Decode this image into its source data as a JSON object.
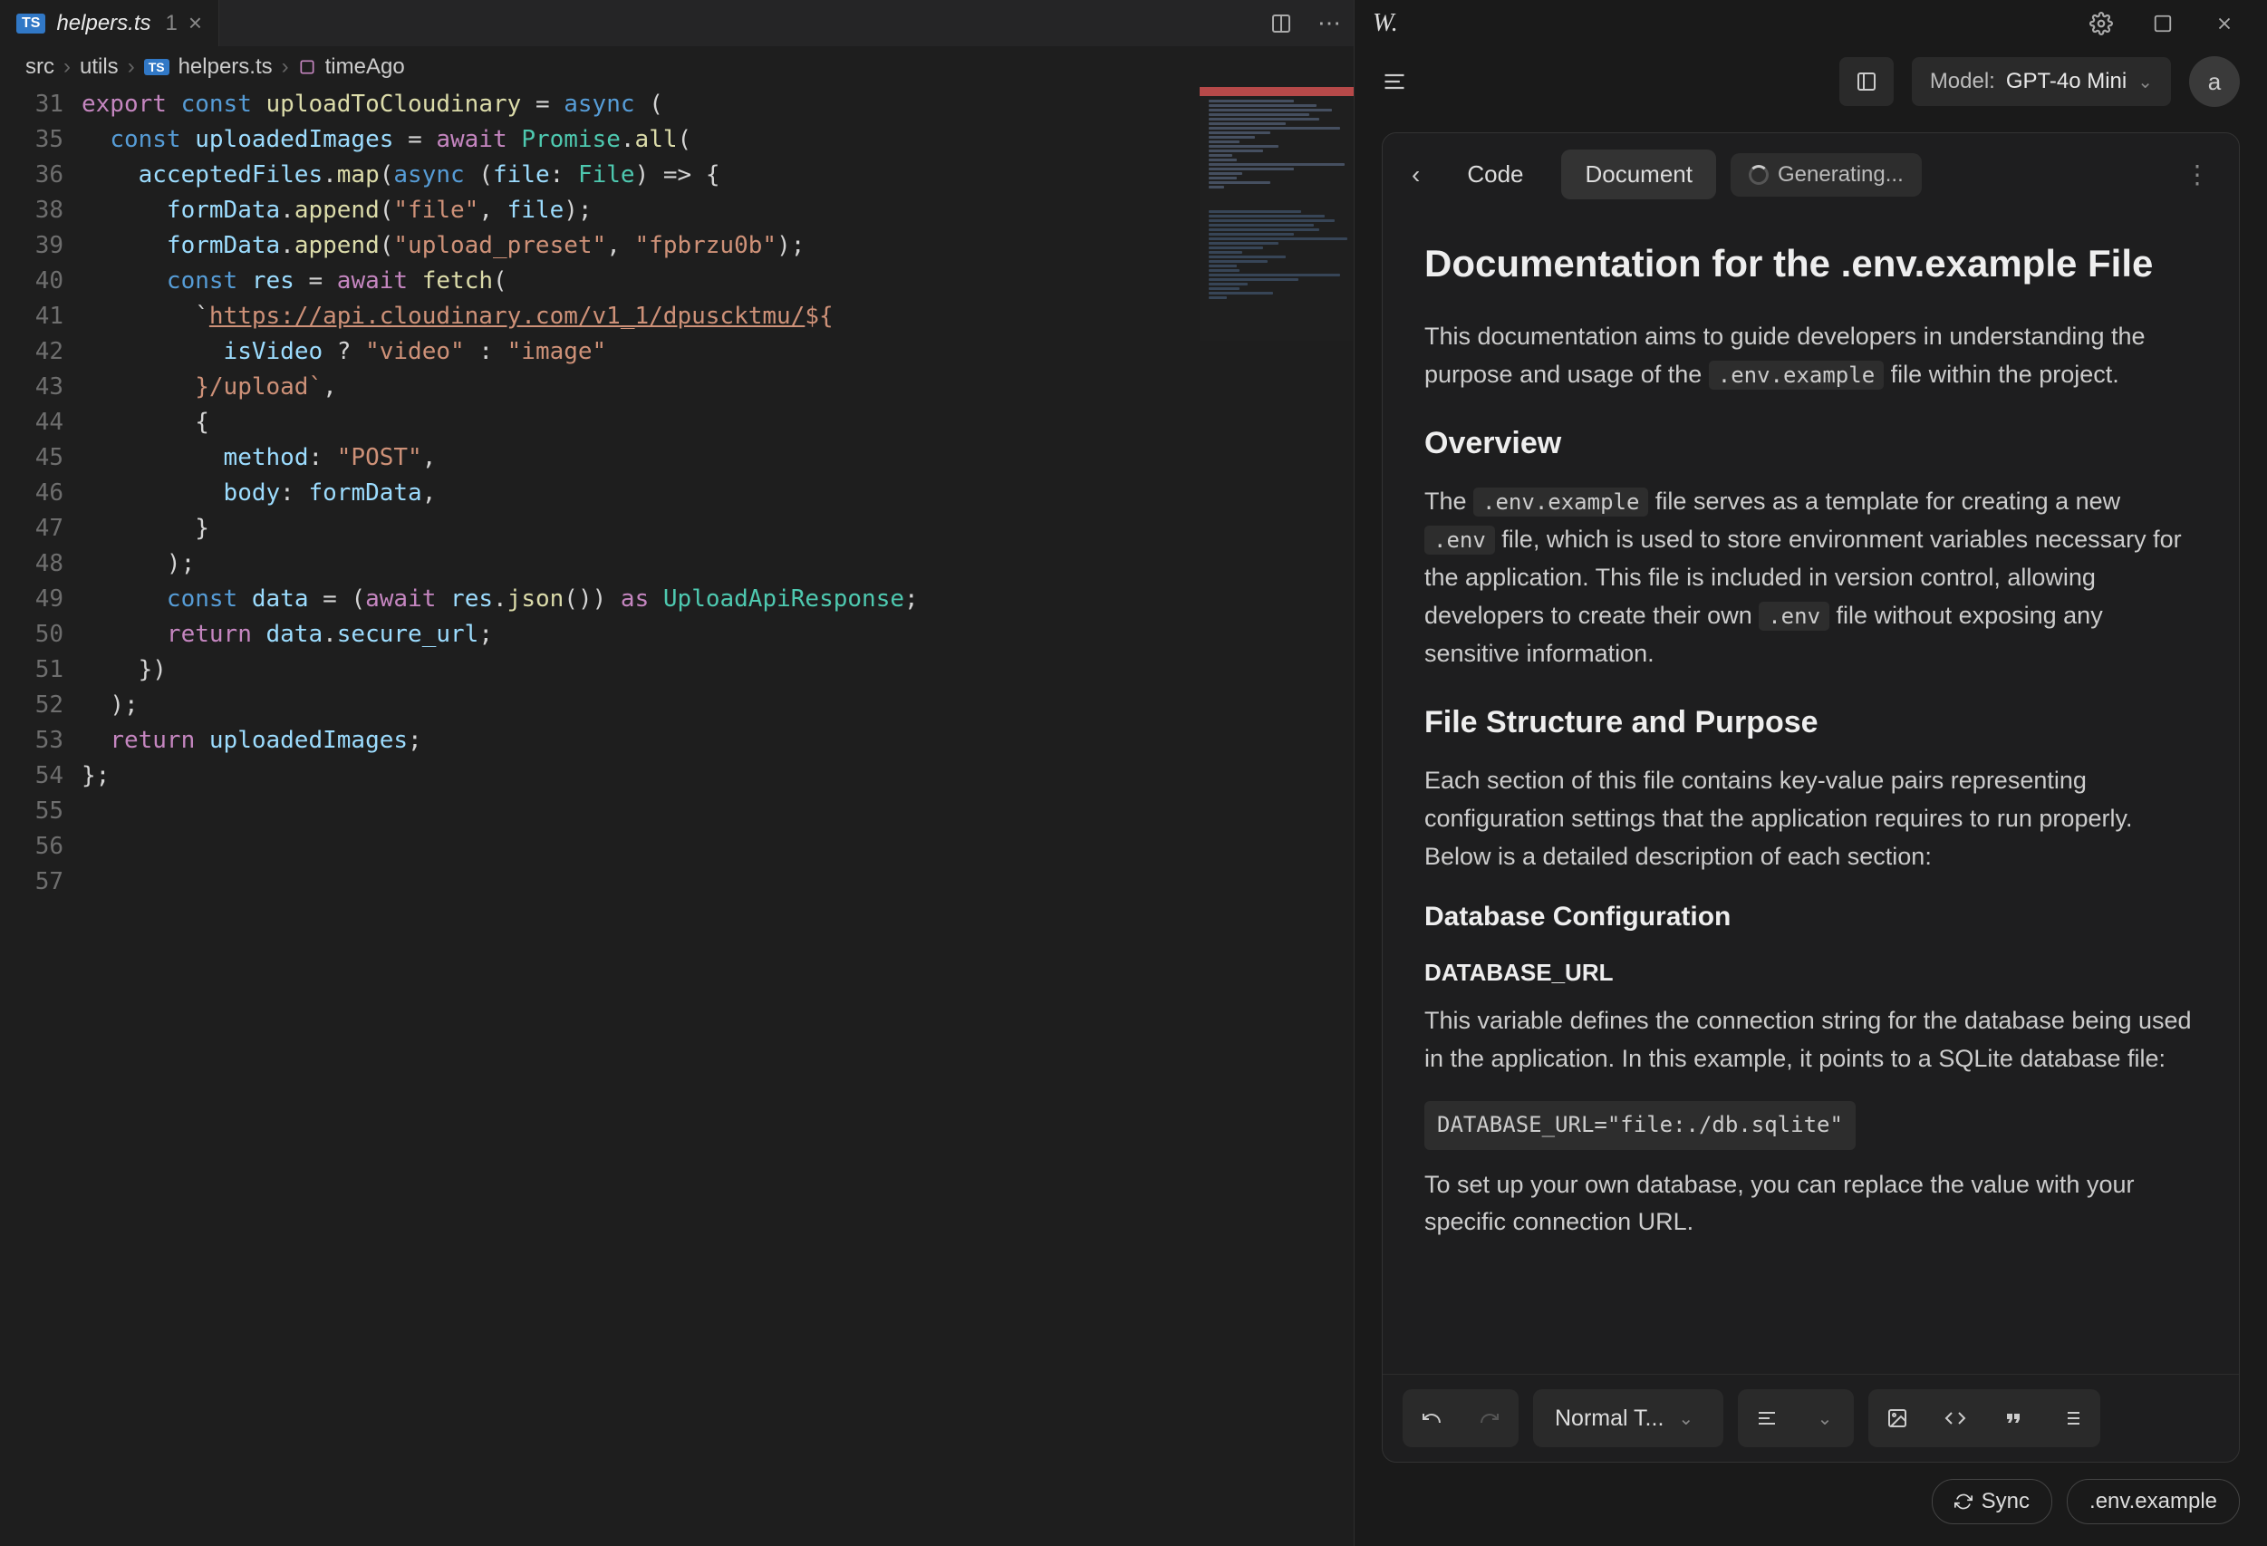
{
  "tab": {
    "file_name": "helpers.ts",
    "problems_count": "1",
    "ts_badge": "TS"
  },
  "breadcrumb": {
    "seg1": "src",
    "seg2": "utils",
    "seg3": "helpers.ts",
    "seg4": "timeAgo"
  },
  "code_lines": [
    {
      "n": "31",
      "html": "<span class='kw'>export</span> <span class='kw2'>const</span> <span class='fn'>uploadToCloudinary</span> <span class='op'>=</span> <span class='kw2'>async</span> <span class='pun'>(</span>"
    },
    {
      "n": "35",
      "html": "  <span class='kw2'>const</span> <span class='var'>uploadedImages</span> <span class='op'>=</span> <span class='kw'>await</span> <span class='type'>Promise</span><span class='pun'>.</span><span class='fn'>all</span><span class='pun'>(</span>"
    },
    {
      "n": "36",
      "html": "    <span class='var'>acceptedFiles</span><span class='pun'>.</span><span class='fn'>map</span><span class='pun'>(</span><span class='kw2'>async</span> <span class='pun'>(</span><span class='var'>file</span><span class='pun'>:</span> <span class='type'>File</span><span class='pun'>)</span> <span class='op'>=&gt;</span> <span class='pun'>{</span>"
    },
    {
      "n": "38",
      "html": "      <span class='var'>formData</span><span class='pun'>.</span><span class='fn'>append</span><span class='pun'>(</span><span class='str'>\"file\"</span><span class='pun'>,</span> <span class='var'>file</span><span class='pun'>);</span>"
    },
    {
      "n": "39",
      "html": "      <span class='var'>formData</span><span class='pun'>.</span><span class='fn'>append</span><span class='pun'>(</span><span class='str'>\"upload_preset\"</span><span class='pun'>,</span> <span class='str'>\"fpbrzu0b\"</span><span class='pun'>);</span>"
    },
    {
      "n": "40",
      "html": "      <span class='kw2'>const</span> <span class='var'>res</span> <span class='op'>=</span> <span class='kw'>await</span> <span class='fn'>fetch</span><span class='pun'>(</span>"
    },
    {
      "n": "41",
      "html": "        <span class='pun'>`</span><span class='url'>https://api.cloudinary.com/v1_1/dpuscktmu/</span><span class='str'>${</span>"
    },
    {
      "n": "42",
      "html": "          <span class='var'>isVideo</span> <span class='op'>?</span> <span class='str'>\"video\"</span> <span class='op'>:</span> <span class='str'>\"image\"</span>"
    },
    {
      "n": "43",
      "html": "        <span class='str'>}/upload`</span><span class='pun'>,</span>"
    },
    {
      "n": "44",
      "html": "        <span class='pun'>{</span>"
    },
    {
      "n": "45",
      "html": "          <span class='var'>method</span><span class='pun'>:</span> <span class='str'>\"POST\"</span><span class='pun'>,</span>"
    },
    {
      "n": "46",
      "html": "          <span class='var'>body</span><span class='pun'>:</span> <span class='var'>formData</span><span class='pun'>,</span>"
    },
    {
      "n": "47",
      "html": "        <span class='pun'>}</span>"
    },
    {
      "n": "48",
      "html": "      <span class='pun'>);</span>"
    },
    {
      "n": "49",
      "html": "      <span class='kw2'>const</span> <span class='var'>data</span> <span class='op'>=</span> <span class='pun'>(</span><span class='kw'>await</span> <span class='var'>res</span><span class='pun'>.</span><span class='fn'>json</span><span class='pun'>())</span> <span class='kw'>as</span> <span class='type'>UploadApiResponse</span><span class='pun'>;</span>"
    },
    {
      "n": "50",
      "html": "      <span class='kw'>return</span> <span class='var'>data</span><span class='pun'>.</span><span class='var'>secure_url</span><span class='pun'>;</span>"
    },
    {
      "n": "51",
      "html": "    <span class='pun'>})</span>"
    },
    {
      "n": "52",
      "html": "  <span class='pun'>);</span>"
    },
    {
      "n": "53",
      "html": "  <span class='kw'>return</span> <span class='var'>uploadedImages</span><span class='pun'>;</span>"
    },
    {
      "n": "54",
      "html": "<span class='pun'>};</span>"
    },
    {
      "n": "55",
      "html": ""
    },
    {
      "n": "56",
      "html": ""
    },
    {
      "n": "57",
      "html": ""
    }
  ],
  "right_header": {
    "logo": "W."
  },
  "toolbar": {
    "model_label": "Model:",
    "model_value": "GPT-4o Mini",
    "avatar_initial": "a"
  },
  "doc_tabs": {
    "code": "Code",
    "document": "Document",
    "generating": "Generating..."
  },
  "doc": {
    "title": "Documentation for the .env.example File",
    "intro_pre": "This documentation aims to guide developers in understanding the purpose and usage of the ",
    "intro_code": ".env.example",
    "intro_post": " file within the project.",
    "overview_h": "Overview",
    "overview_p1_pre": "The ",
    "overview_code1": ".env.example",
    "overview_p1_mid": " file serves as a template for creating a new ",
    "overview_code2": ".env",
    "overview_p1_mid2": " file, which is used to store environment variables necessary for the application. This file is included in version control, allowing developers to create their own ",
    "overview_code3": ".env",
    "overview_p1_post": " file without exposing any sensitive information.",
    "fsp_h": "File Structure and Purpose",
    "fsp_p": "Each section of this file contains key-value pairs representing configuration settings that the application requires to run properly. Below is a detailed description of each section:",
    "db_h": "Database Configuration",
    "db_url_h": "DATABASE_URL",
    "db_url_p": "This variable defines the connection string for the database being used in the application. In this example, it points to a SQLite database file:",
    "db_code": "DATABASE_URL=\"file:./db.sqlite\"",
    "db_setup_p": "To set up your own database, you can replace the value with your specific connection URL."
  },
  "bottom_toolbar": {
    "text_style": "Normal T..."
  },
  "footer": {
    "sync": "Sync",
    "env_example": ".env.example"
  }
}
